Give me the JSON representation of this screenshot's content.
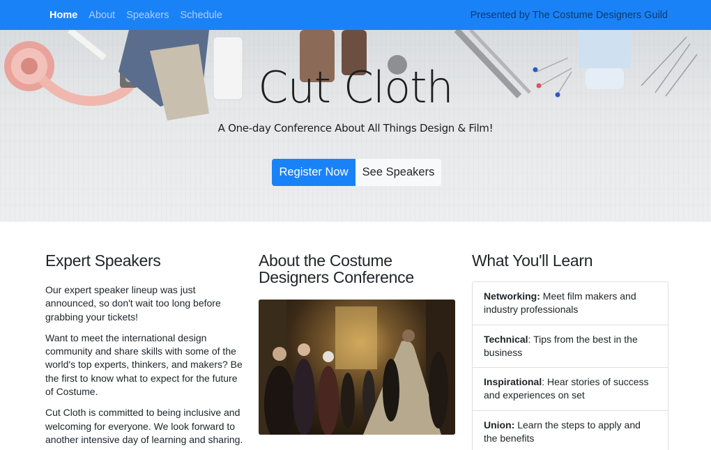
{
  "nav": {
    "links": [
      {
        "label": "Home",
        "active": true
      },
      {
        "label": "About",
        "active": false
      },
      {
        "label": "Speakers",
        "active": false
      },
      {
        "label": "Schedule",
        "active": false
      }
    ],
    "presented_by": "Presented by The Costume Designers Guild"
  },
  "hero": {
    "title": "Cut Cloth",
    "subtitle": "A One-day Conference About All Things Design & Film!",
    "primary_button": "Register Now",
    "secondary_button": "See Speakers"
  },
  "speakers": {
    "heading": "Expert Speakers",
    "paragraphs": [
      "Our expert speaker lineup was just announced, so don't wait too long before grabbing your tickets!",
      "Want to meet the international design community and share skills with some of the world's top experts, thinkers, and makers? Be the first to know what to expect for the future of Costume.",
      "Cut Cloth is committed to being inclusive and welcoming for everyone. We look forward to another intensive day of learning and sharing."
    ]
  },
  "about": {
    "heading": "About the Costume Designers Conference"
  },
  "learn": {
    "heading": "What You'll Learn",
    "items": [
      {
        "title": "Networking:",
        "text": " Meet film makers and industry professionals"
      },
      {
        "title": "Technical",
        "text": ": Tips from the best in the business"
      },
      {
        "title": "Inspirational",
        "text": ": Hear stories of success and experiences on set"
      },
      {
        "title": "Union:",
        "text": " Learn the steps to apply and the benefits"
      }
    ]
  },
  "colors": {
    "primary": "#1a82f7",
    "light_button": "#f8f9fa",
    "text": "#212529"
  }
}
